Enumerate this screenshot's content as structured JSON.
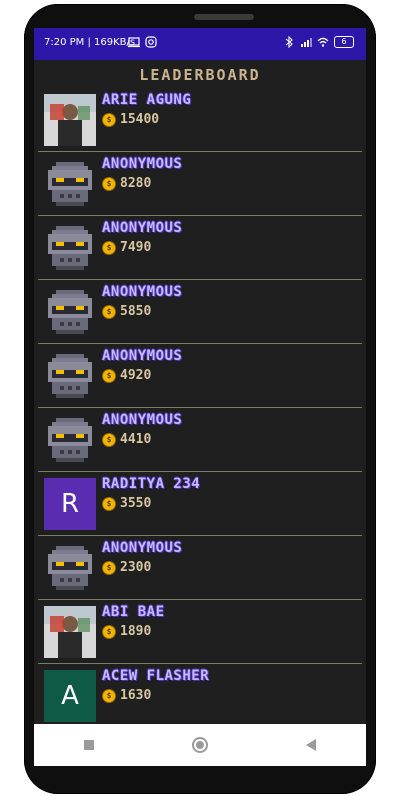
{
  "status_bar": {
    "time": "7:20 PM | 169KB/s",
    "icons": [
      "screen-icon",
      "camera-icon",
      "bluetooth-icon",
      "signal-icon",
      "wifi-icon",
      "battery-icon"
    ],
    "battery": "6"
  },
  "header": {
    "title": "LEADERBOARD"
  },
  "leaderboard": [
    {
      "name": "ARIE AGUNG",
      "score": "15400",
      "avatar": "photo"
    },
    {
      "name": "ANONYMOUS",
      "score": "8280",
      "avatar": "pixel-skull"
    },
    {
      "name": "ANONYMOUS",
      "score": "7490",
      "avatar": "pixel-skull"
    },
    {
      "name": "ANONYMOUS",
      "score": "5850",
      "avatar": "pixel-skull"
    },
    {
      "name": "ANONYMOUS",
      "score": "4920",
      "avatar": "pixel-skull"
    },
    {
      "name": "ANONYMOUS",
      "score": "4410",
      "avatar": "pixel-skull"
    },
    {
      "name": "RADITYA 234",
      "score": "3550",
      "avatar": "letter",
      "letter": "R",
      "color": "#5a2db0"
    },
    {
      "name": "ANONYMOUS",
      "score": "2300",
      "avatar": "pixel-skull"
    },
    {
      "name": "ABI BAE",
      "score": "1890",
      "avatar": "photo"
    },
    {
      "name": "ACEW FLASHER",
      "score": "1630",
      "avatar": "letter",
      "letter": "A",
      "color": "#0f5a46"
    }
  ],
  "nav": {
    "recent": "square-icon",
    "home": "circle-icon",
    "back": "triangle-back-icon"
  },
  "colors": {
    "status_bar": "#2c17a8",
    "name_fill": "#c5b8ff",
    "score_text": "#d7c7a2",
    "title": "#c9b48f",
    "coin": "#f1b500"
  }
}
